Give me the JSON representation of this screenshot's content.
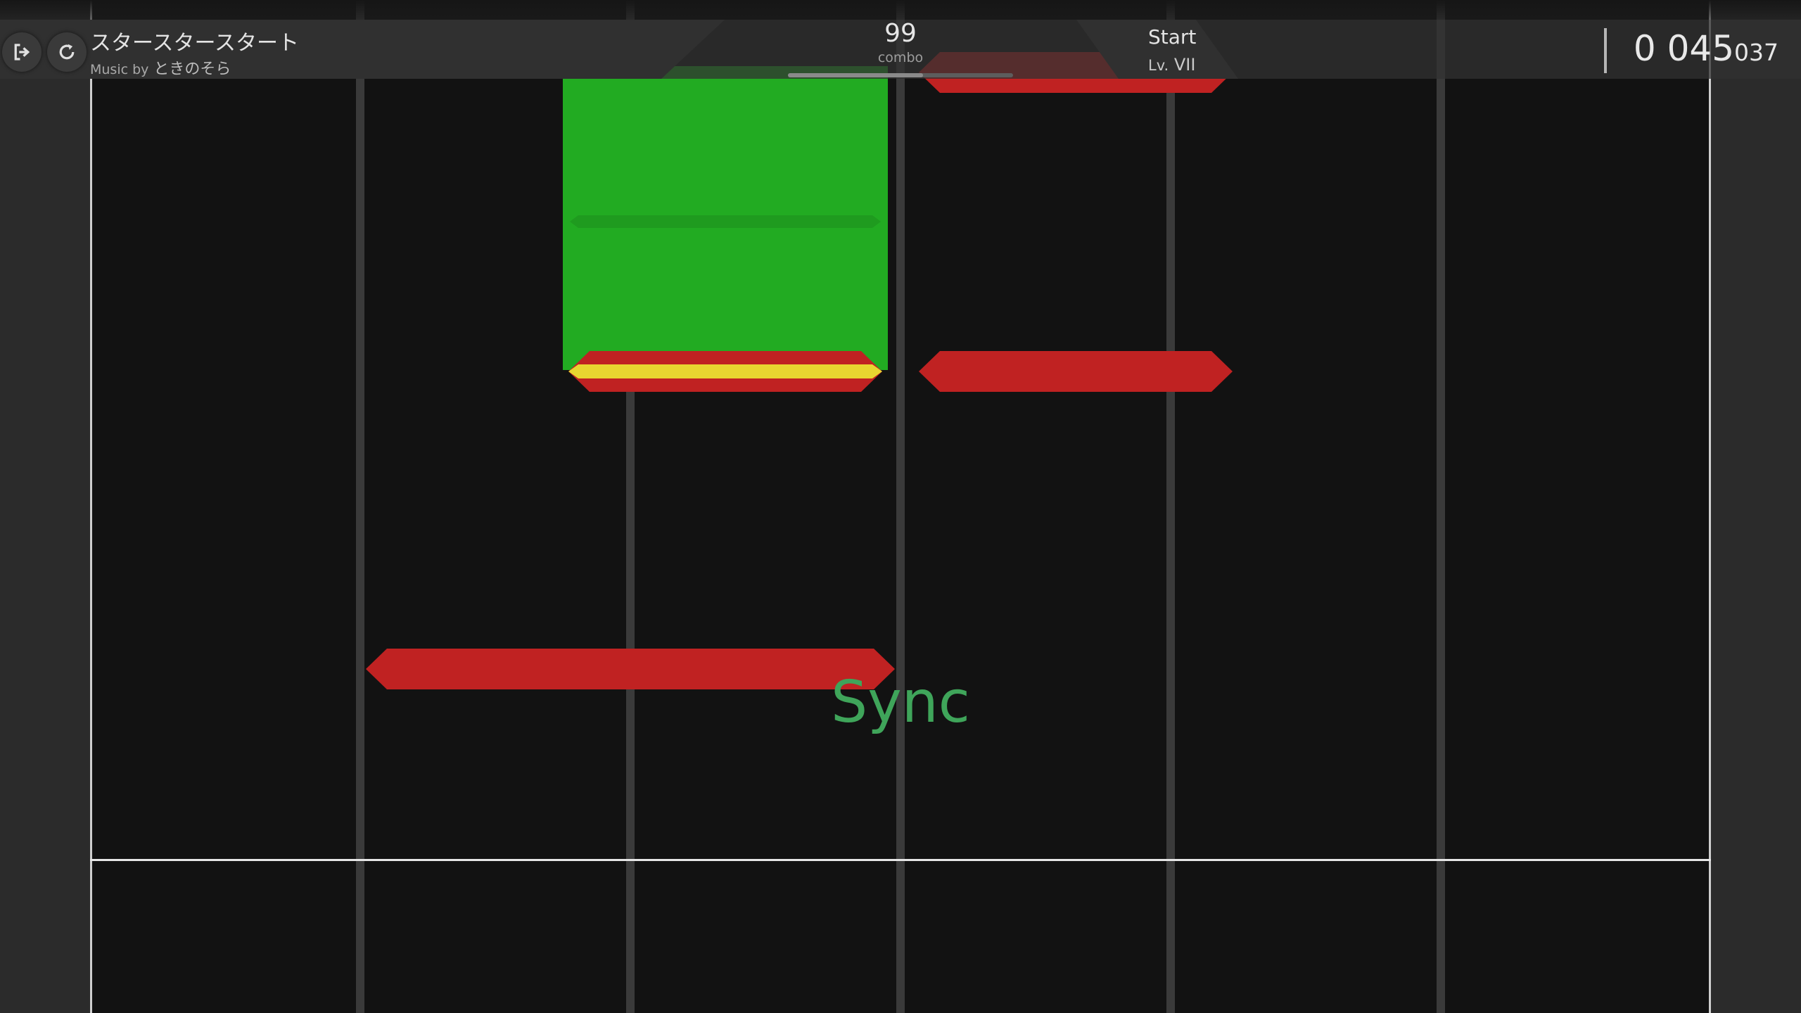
{
  "song": {
    "title": "スタースタースタート",
    "artist_prefix": "Music by",
    "artist": "ときのそら"
  },
  "combo": {
    "value": "99",
    "label": "combo"
  },
  "progress": {
    "fraction": 0.6
  },
  "difficulty": {
    "name": "Start",
    "level_prefix": "Lv.",
    "level": "VII"
  },
  "score": {
    "major": "0 045",
    "minor": "037"
  },
  "judgement": "Sync",
  "icons": {
    "exit": "exit-icon",
    "retry": "retry-icon"
  },
  "colors": {
    "tap_note": "#c02222",
    "hold_note": "#22ab22",
    "hold_head_highlight": "#e8d630",
    "judgement_sync": "#3fa55a"
  }
}
